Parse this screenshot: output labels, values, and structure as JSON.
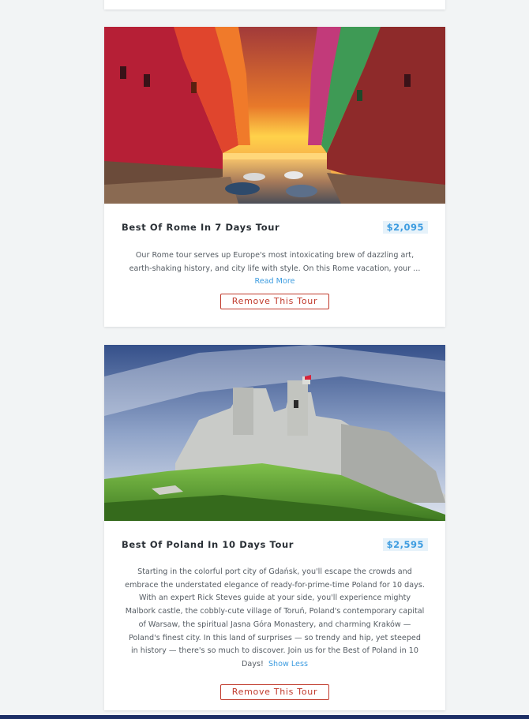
{
  "tours": [
    {
      "title": "Best Of Rome In 7 Days Tour",
      "price": "$2,095",
      "description": "Our Rome tour serves up Europe's most intoxicating brew of dazzling art, earth-shaking history, and city life with style. On this Rome vacation, your ...",
      "toggle_label": "Read More",
      "remove_label": "Remove This Tour"
    },
    {
      "title": "Best Of Poland In 10 Days Tour",
      "price": "$2,595",
      "description": "Starting in the colorful port city of Gdańsk, you'll escape the crowds and embrace the understated elegance of ready-for-prime-time Poland for 10 days. With an expert Rick Steves guide at your side, you'll experience mighty Malbork castle, the cobbly-cute village of Toruń, Poland's contemporary capital of Warsaw, the spiritual Jasna Góra Monastery, and charming Kraków — Poland's finest city. In this land of surprises — so trendy and hip, yet steeped in history — there's so much to discover. Join us for the Best of Poland in 10 Days!",
      "toggle_label": "Show Less",
      "remove_label": "Remove This Tour"
    }
  ],
  "colors": {
    "accent_blue": "#3d9ce0",
    "remove_red": "#c0392b",
    "footer_navy": "#1d2f66"
  }
}
